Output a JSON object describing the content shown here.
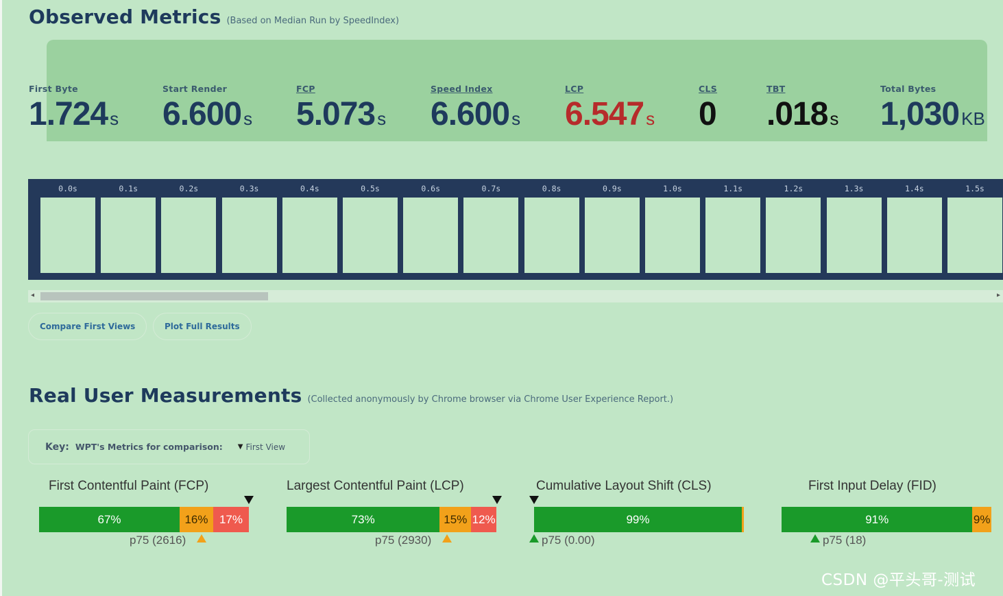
{
  "observed": {
    "title": "Observed Metrics",
    "subtitle": "(Based on Median Run by SpeedIndex)",
    "metrics": [
      {
        "label": "First Byte",
        "value": "1.724",
        "unit": "s",
        "color": "#1e3a5c"
      },
      {
        "label": "Start Render",
        "value": "6.600",
        "unit": "s",
        "color": "#1e3a5c"
      },
      {
        "label": "FCP",
        "value": "5.073",
        "unit": "s",
        "color": "#1e3a5c"
      },
      {
        "label": "Speed Index",
        "value": "6.600",
        "unit": "s",
        "color": "#1e3a5c"
      },
      {
        "label": "LCP",
        "value": "6.547",
        "unit": "s",
        "color": "#b62b2b"
      },
      {
        "label": "CLS",
        "value": "0",
        "unit": "",
        "color": "#111111"
      },
      {
        "label": "TBT",
        "value": ".018",
        "unit": "s",
        "color": "#111111"
      },
      {
        "label": "Total Bytes",
        "value": "1,030",
        "unit": "KB",
        "color": "#1e3a5c"
      }
    ]
  },
  "filmstrip": {
    "times": [
      "0.0s",
      "0.1s",
      "0.2s",
      "0.3s",
      "0.4s",
      "0.5s",
      "0.6s",
      "0.7s",
      "0.8s",
      "0.9s",
      "1.0s",
      "1.1s",
      "1.2s",
      "1.3s",
      "1.4s",
      "1.5s"
    ]
  },
  "buttons": {
    "compare": "Compare First Views",
    "plot": "Plot Full Results"
  },
  "rum": {
    "title": "Real User Measurements",
    "subtitle": "(Collected anonymously by Chrome browser via Chrome User Experience Report.)",
    "key": {
      "label": "Key:",
      "text": "WPT's Metrics for comparison:",
      "marker": "▼",
      "first_view": "First View"
    },
    "cards": [
      {
        "title": "First Contentful Paint (FCP)",
        "good": "67%",
        "mid": "16%",
        "poor": "17%",
        "p75": "p75 (2616)",
        "good_frac": 0.67,
        "mid_frac": 0.16,
        "poor_frac": 0.17
      },
      {
        "title": "Largest Contentful Paint (LCP)",
        "good": "73%",
        "mid": "15%",
        "poor": "12%",
        "p75": "p75 (2930)",
        "good_frac": 0.73,
        "mid_frac": 0.15,
        "poor_frac": 0.12
      },
      {
        "title": "Cumulative Layout Shift (CLS)",
        "good": "99%",
        "mid": "",
        "poor": "",
        "p75": "p75 (0.00)",
        "good_frac": 0.99,
        "mid_frac": 0.01,
        "poor_frac": 0.0
      },
      {
        "title": "First Input Delay (FID)",
        "good": "91%",
        "mid": "9%",
        "poor": "",
        "p75": "p75 (18)",
        "good_frac": 0.91,
        "mid_frac": 0.09,
        "poor_frac": 0.0
      }
    ]
  },
  "watermark": "CSDN @平头哥-测试",
  "colors": {
    "background": "#c1e6c6",
    "heading": "#1e3a5c",
    "good": "#1a9a2a",
    "needs_improvement": "#f2a11a",
    "poor": "#ef5a4e",
    "lcp_value": "#b62b2b"
  }
}
